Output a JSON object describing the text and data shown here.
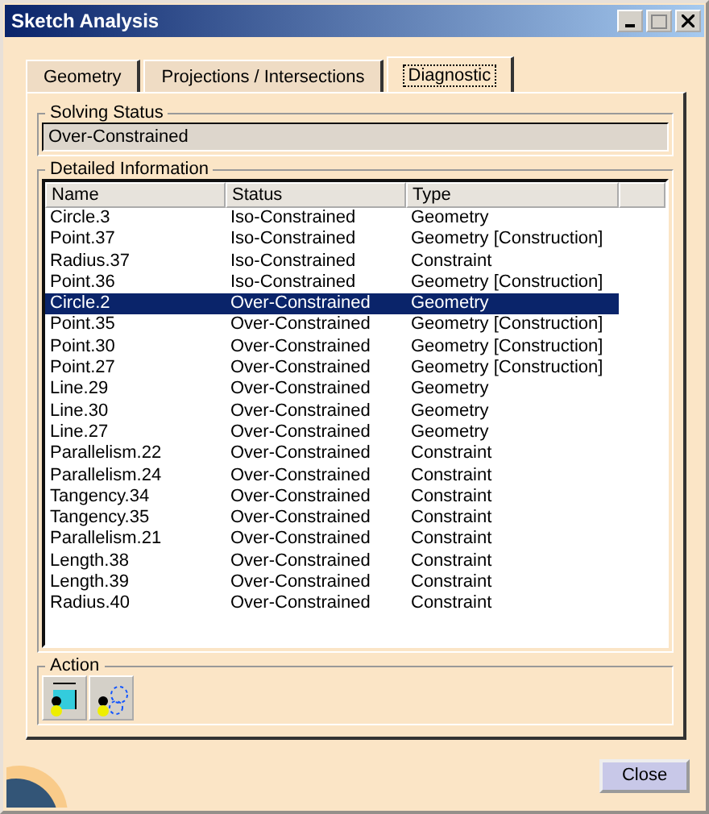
{
  "window": {
    "title": "Sketch Analysis"
  },
  "tabs": [
    {
      "label": "Geometry",
      "selected": false
    },
    {
      "label": "Projections / Intersections",
      "selected": false
    },
    {
      "label": "Diagnostic",
      "selected": true
    }
  ],
  "solving_status": {
    "title": "Solving Status",
    "value": "Over-Constrained"
  },
  "detailed_information": {
    "title": "Detailed Information",
    "columns": [
      "Name",
      "Status",
      "Type"
    ],
    "rows": [
      {
        "name": "Circle.3",
        "status": "Iso-Constrained",
        "type": "Geometry",
        "selected": false
      },
      {
        "name": "Point.37",
        "status": "Iso-Constrained",
        "type": "Geometry [Construction]",
        "selected": false
      },
      {
        "name": "Radius.37",
        "status": "Iso-Constrained",
        "type": "Constraint",
        "selected": false
      },
      {
        "name": "Point.36",
        "status": "Iso-Constrained",
        "type": "Geometry [Construction]",
        "selected": false
      },
      {
        "name": "Circle.2",
        "status": "Over-Constrained",
        "type": "Geometry",
        "selected": true
      },
      {
        "name": "Point.35",
        "status": "Over-Constrained",
        "type": "Geometry [Construction]",
        "selected": false
      },
      {
        "name": "Point.30",
        "status": "Over-Constrained",
        "type": "Geometry [Construction]",
        "selected": false
      },
      {
        "name": "Point.27",
        "status": "Over-Constrained",
        "type": "Geometry [Construction]",
        "selected": false
      },
      {
        "name": "Line.29",
        "status": "Over-Constrained",
        "type": "Geometry",
        "selected": false
      },
      {
        "name": "Line.30",
        "status": "Over-Constrained",
        "type": "Geometry",
        "selected": false
      },
      {
        "name": "Line.27",
        "status": "Over-Constrained",
        "type": "Geometry",
        "selected": false
      },
      {
        "name": "Parallelism.22",
        "status": "Over-Constrained",
        "type": "Constraint",
        "selected": false
      },
      {
        "name": "Parallelism.24",
        "status": "Over-Constrained",
        "type": "Constraint",
        "selected": false
      },
      {
        "name": "Tangency.34",
        "status": "Over-Constrained",
        "type": "Constraint",
        "selected": false
      },
      {
        "name": "Tangency.35",
        "status": "Over-Constrained",
        "type": "Constraint",
        "selected": false
      },
      {
        "name": "Parallelism.21",
        "status": "Over-Constrained",
        "type": "Constraint",
        "selected": false
      },
      {
        "name": "Length.38",
        "status": "Over-Constrained",
        "type": "Constraint",
        "selected": false
      },
      {
        "name": "Length.39",
        "status": "Over-Constrained",
        "type": "Constraint",
        "selected": false
      },
      {
        "name": "Radius.40",
        "status": "Over-Constrained",
        "type": "Constraint",
        "selected": false
      }
    ]
  },
  "action": {
    "title": "Action"
  },
  "buttons": [
    "Close"
  ]
}
